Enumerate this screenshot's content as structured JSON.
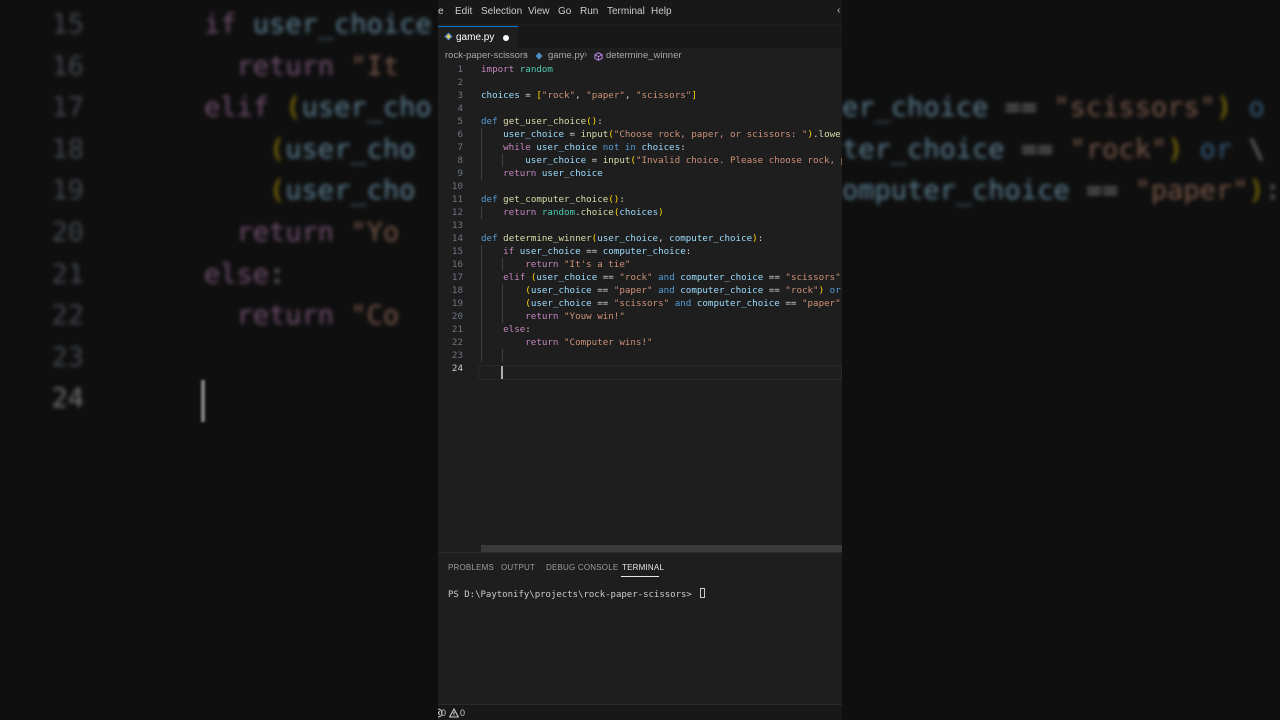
{
  "menu": {
    "items": [
      "e",
      "Edit",
      "Selection",
      "View",
      "Go",
      "Run",
      "Terminal",
      "Help"
    ]
  },
  "tab": {
    "label": "game.py",
    "modified": true
  },
  "breadcrumb": {
    "folder": "rock-paper-scissors",
    "file": "game.py",
    "symbol": "determine_winner"
  },
  "editor": {
    "line_numbers": [
      "1",
      "2",
      "3",
      "4",
      "5",
      "6",
      "7",
      "8",
      "9",
      "10",
      "11",
      "12",
      "13",
      "14",
      "15",
      "16",
      "17",
      "18",
      "19",
      "20",
      "21",
      "22",
      "23",
      "24"
    ],
    "current_line": 24,
    "lines": [
      [
        [
          "kw",
          "import"
        ],
        [
          "pl",
          " "
        ],
        [
          "mod",
          "random"
        ]
      ],
      [],
      [
        [
          "vr",
          "choices"
        ],
        [
          "pl",
          " = "
        ],
        [
          "br1",
          "["
        ],
        [
          "st",
          "\"rock\""
        ],
        [
          "pl",
          ", "
        ],
        [
          "st",
          "\"paper\""
        ],
        [
          "pl",
          ", "
        ],
        [
          "st",
          "\"scissors\""
        ],
        [
          "br1",
          "]"
        ]
      ],
      [],
      [
        [
          "bk",
          "def"
        ],
        [
          "pl",
          " "
        ],
        [
          "fn",
          "get_user_choice"
        ],
        [
          "br1",
          "()"
        ],
        [
          "pl",
          ":"
        ]
      ],
      [
        [
          "pl",
          "    "
        ],
        [
          "vr",
          "user_choice"
        ],
        [
          "pl",
          " = "
        ],
        [
          "fn",
          "input"
        ],
        [
          "br1",
          "("
        ],
        [
          "st",
          "\"Choose rock, paper, or scissors: \""
        ],
        [
          "br1",
          ")"
        ],
        [
          "pl",
          "."
        ],
        [
          "fn",
          "lower"
        ],
        [
          "br1",
          "()"
        ]
      ],
      [
        [
          "pl",
          "    "
        ],
        [
          "kw",
          "while"
        ],
        [
          "pl",
          " "
        ],
        [
          "vr",
          "user_choice"
        ],
        [
          "pl",
          " "
        ],
        [
          "bk",
          "not in"
        ],
        [
          "pl",
          " "
        ],
        [
          "vr",
          "choices"
        ],
        [
          "pl",
          ":"
        ]
      ],
      [
        [
          "pl",
          "        "
        ],
        [
          "vr",
          "user_choice"
        ],
        [
          "pl",
          " = "
        ],
        [
          "fn",
          "input"
        ],
        [
          "br1",
          "("
        ],
        [
          "st",
          "\"Invalid choice. Please choose rock, paper, or scissors: \""
        ],
        [
          "br1",
          ")"
        ]
      ],
      [
        [
          "pl",
          "    "
        ],
        [
          "kw",
          "return"
        ],
        [
          "pl",
          " "
        ],
        [
          "vr",
          "user_choice"
        ]
      ],
      [],
      [
        [
          "bk",
          "def"
        ],
        [
          "pl",
          " "
        ],
        [
          "fn",
          "get_computer_choice"
        ],
        [
          "br1",
          "()"
        ],
        [
          "pl",
          ":"
        ]
      ],
      [
        [
          "pl",
          "    "
        ],
        [
          "kw",
          "return"
        ],
        [
          "pl",
          " "
        ],
        [
          "mod",
          "random"
        ],
        [
          "pl",
          "."
        ],
        [
          "fn",
          "choice"
        ],
        [
          "br1",
          "("
        ],
        [
          "vr",
          "choices"
        ],
        [
          "br1",
          ")"
        ]
      ],
      [],
      [
        [
          "bk",
          "def"
        ],
        [
          "pl",
          " "
        ],
        [
          "fn",
          "determine_winner"
        ],
        [
          "br1",
          "("
        ],
        [
          "vr",
          "user_choice"
        ],
        [
          "pl",
          ", "
        ],
        [
          "vr",
          "computer_choice"
        ],
        [
          "br1",
          ")"
        ],
        [
          "pl",
          ":"
        ]
      ],
      [
        [
          "pl",
          "    "
        ],
        [
          "kw",
          "if"
        ],
        [
          "pl",
          " "
        ],
        [
          "vr",
          "user_choice"
        ],
        [
          "pl",
          " == "
        ],
        [
          "vr",
          "computer_choice"
        ],
        [
          "pl",
          ":"
        ]
      ],
      [
        [
          "pl",
          "        "
        ],
        [
          "kw",
          "return"
        ],
        [
          "pl",
          " "
        ],
        [
          "st",
          "\"It's a tie\""
        ]
      ],
      [
        [
          "pl",
          "    "
        ],
        [
          "kw",
          "elif"
        ],
        [
          "pl",
          " "
        ],
        [
          "br1",
          "("
        ],
        [
          "vr",
          "user_choice"
        ],
        [
          "pl",
          " == "
        ],
        [
          "st",
          "\"rock\""
        ],
        [
          "pl",
          " "
        ],
        [
          "bk",
          "and"
        ],
        [
          "pl",
          " "
        ],
        [
          "vr",
          "computer_choice"
        ],
        [
          "pl",
          " == "
        ],
        [
          "st",
          "\"scissors\""
        ],
        [
          "br1",
          ")"
        ],
        [
          "pl",
          " "
        ],
        [
          "bk",
          "or"
        ],
        [
          "pl",
          " \\"
        ]
      ],
      [
        [
          "pl",
          "        "
        ],
        [
          "br1",
          "("
        ],
        [
          "vr",
          "user_choice"
        ],
        [
          "pl",
          " == "
        ],
        [
          "st",
          "\"paper\""
        ],
        [
          "pl",
          " "
        ],
        [
          "bk",
          "and"
        ],
        [
          "pl",
          " "
        ],
        [
          "vr",
          "computer_choice"
        ],
        [
          "pl",
          " == "
        ],
        [
          "st",
          "\"rock\""
        ],
        [
          "br1",
          ")"
        ],
        [
          "pl",
          " "
        ],
        [
          "bk",
          "or"
        ],
        [
          "pl",
          " \\"
        ]
      ],
      [
        [
          "pl",
          "        "
        ],
        [
          "br1",
          "("
        ],
        [
          "vr",
          "user_choice"
        ],
        [
          "pl",
          " == "
        ],
        [
          "st",
          "\"scissors\""
        ],
        [
          "pl",
          " "
        ],
        [
          "bk",
          "and"
        ],
        [
          "pl",
          " "
        ],
        [
          "vr",
          "computer_choice"
        ],
        [
          "pl",
          " == "
        ],
        [
          "st",
          "\"paper\""
        ],
        [
          "br1",
          ")"
        ],
        [
          "pl",
          ":"
        ]
      ],
      [
        [
          "pl",
          "        "
        ],
        [
          "kw",
          "return"
        ],
        [
          "pl",
          " "
        ],
        [
          "st",
          "\"Youw win!\""
        ]
      ],
      [
        [
          "pl",
          "    "
        ],
        [
          "kw",
          "else"
        ],
        [
          "pl",
          ":"
        ]
      ],
      [
        [
          "pl",
          "        "
        ],
        [
          "kw",
          "return"
        ],
        [
          "pl",
          " "
        ],
        [
          "st",
          "\"Computer wins!\""
        ]
      ],
      [],
      []
    ]
  },
  "panel": {
    "tabs": [
      "PROBLEMS",
      "OUTPUT",
      "DEBUG CONSOLE",
      "TERMINAL"
    ],
    "active_tab": "TERMINAL",
    "terminal_prompt": "PS D:\\Paytonify\\projects\\rock-paper-scissors> "
  },
  "status": {
    "errors": "0",
    "warnings": "0"
  },
  "background": {
    "left_lines": [
      {
        "n": "15",
        "t": [
          [
            "kw",
            "if"
          ],
          [
            "pl",
            " "
          ],
          [
            "vr",
            "user_choice"
          ]
        ]
      },
      {
        "n": "16",
        "t": [
          [
            "pl",
            "  "
          ],
          [
            "kw",
            "return"
          ],
          [
            "pl",
            " "
          ],
          [
            "st",
            "\"It"
          ]
        ]
      },
      {
        "n": "17",
        "t": [
          [
            "kw",
            "elif"
          ],
          [
            "pl",
            " "
          ],
          [
            "br1",
            "("
          ],
          [
            "vr",
            "user_cho"
          ]
        ]
      },
      {
        "n": "18",
        "t": [
          [
            "pl",
            "    "
          ],
          [
            "br1",
            "("
          ],
          [
            "vr",
            "user_cho"
          ]
        ]
      },
      {
        "n": "19",
        "t": [
          [
            "pl",
            "    "
          ],
          [
            "br1",
            "("
          ],
          [
            "vr",
            "user_cho"
          ]
        ]
      },
      {
        "n": "20",
        "t": [
          [
            "pl",
            "  "
          ],
          [
            "kw",
            "return"
          ],
          [
            "pl",
            " "
          ],
          [
            "st",
            "\"Yo"
          ]
        ]
      },
      {
        "n": "21",
        "t": [
          [
            "kw",
            "else"
          ],
          [
            "pl",
            ":"
          ]
        ]
      },
      {
        "n": "22",
        "t": [
          [
            "pl",
            "  "
          ],
          [
            "kw",
            "return"
          ],
          [
            "pl",
            " "
          ],
          [
            "st",
            "\"Co"
          ]
        ]
      },
      {
        "n": "23",
        "t": []
      },
      {
        "n": "24",
        "t": []
      }
    ],
    "right_lines": [
      {
        "row": 2,
        "t": [
          [
            "vr",
            "er_choice"
          ],
          [
            "pl",
            " == "
          ],
          [
            "st",
            "\"scissors\""
          ],
          [
            "br1",
            ")"
          ],
          [
            "pl",
            " "
          ],
          [
            "bk",
            "o"
          ]
        ]
      },
      {
        "row": 3,
        "t": [
          [
            "vr",
            "ter_choice"
          ],
          [
            "pl",
            " == "
          ],
          [
            "st",
            "\"rock\""
          ],
          [
            "br1",
            ")"
          ],
          [
            "pl",
            " "
          ],
          [
            "bk",
            "or"
          ],
          [
            "pl",
            " \\"
          ]
        ]
      },
      {
        "row": 4,
        "t": [
          [
            "vr",
            "omputer_choice"
          ],
          [
            "pl",
            " == "
          ],
          [
            "st",
            "\"paper\""
          ],
          [
            "br1",
            ")"
          ],
          [
            "pl",
            ":"
          ]
        ]
      }
    ]
  }
}
